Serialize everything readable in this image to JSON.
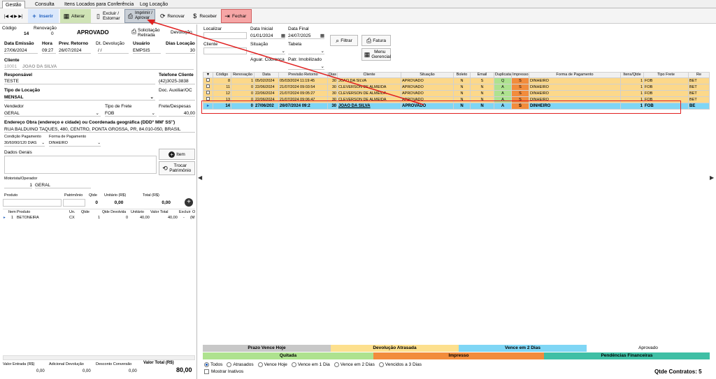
{
  "tabs": [
    "Gestão",
    "Consulta",
    "Itens Locados para Conferência",
    "Log Locação"
  ],
  "toolbar": {
    "nav": "|◀ ◀ ▶ ▶|",
    "insert": "Inserir",
    "alter": "Alterar",
    "delete": "Excluir / Estornar",
    "print": "Imprimir / Aprovar",
    "renew": "Renovar",
    "receive": "Receber",
    "close": "Fechar"
  },
  "form": {
    "codigo_label": "Código",
    "codigo": "14",
    "renovacao_label": "Renovação",
    "renovacao": "0",
    "status": "APROVADO",
    "solicitacao": "Solicitação Retirada",
    "devolucao": "Devolução",
    "data_emissao_label": "Data Emissão",
    "data_emissao": "27/06/2024",
    "hora_label": "Hora",
    "hora": "09:27",
    "prev_retorno_label": "Prev. Retorno",
    "prev_retorno": "26/07/2024",
    "dt_devolucao_label": "Dt. Devolução",
    "dt_devolucao": "/ /",
    "usuario_label": "Usuário",
    "usuario": "EMPSIS",
    "dias_locacao_label": "Dias Locação",
    "dias_locacao": "30",
    "cliente_label": "Cliente",
    "cliente_code": "10001",
    "cliente_name": "JOAO DA SILVA",
    "responsavel_label": "Responsável",
    "responsavel": "TESTE",
    "telefone_label": "Telefone Cliente",
    "telefone": "(42)3025-3838",
    "tipo_locacao_label": "Tipo de Locação",
    "tipo_locacao": "MENSAL",
    "doc_aux_label": "Doc. Auxiliar/OC",
    "vendedor_label": "Vendedor",
    "vendedor": "GERAL",
    "tipo_frete_label": "Tipo de Frete",
    "tipo_frete": "FOB",
    "frete_label": "Frete/Despesas",
    "frete": "40,00",
    "endereco_label": "Endereço Obra (endereço e cidade) ou Coordenada geográfica (DDD° MM' SS'')",
    "endereco": "RUA BALDUINO TAQUES, 480, CENTRO, PONTA GROSSA, PR, 84.010-050, BRASIL",
    "cond_pag_label": "Condição Pagamento",
    "cond_pag": "30/60/90/120 DIAS",
    "forma_pag_label": "Forma de Pagamento",
    "forma_pag": "DINHEIRO",
    "dados_gerais_label": "Dados Gerais",
    "item_btn": "Item",
    "trocar_btn": "Trocar Patrimônio",
    "motorista_label": "Motorista/Operador",
    "motorista_code": "1",
    "motorista": "GERAL",
    "produto_label": "Produto",
    "patrimonio_label": "Patrimônio",
    "qtde_label": "Qtde",
    "qtde": "0",
    "unitario_label": "Unitário (R$)",
    "unitario": "0,00",
    "total_label": "Total (R$)",
    "total": "0,00"
  },
  "items": {
    "headers": [
      "Item",
      "Produto",
      "Un.",
      "Qtde",
      "Qtde Devolvida",
      "Unitário",
      "Valor Total",
      "Excluir",
      "O"
    ],
    "rows": [
      [
        "1",
        "BETONEIRA",
        "CX",
        "1",
        "0",
        "40,00",
        "40,00",
        "-",
        "(M"
      ]
    ]
  },
  "footer": {
    "valor_entrada_label": "Valor Entrada (R$)",
    "valor_entrada": "0,00",
    "adicional_label": "Adicional Devolução",
    "adicional": "0,00",
    "desconto_label": "Desconto Conversão",
    "desconto": "0,00",
    "valor_total_label": "Valor Total (R$)",
    "valor_total": "80,00"
  },
  "filters": {
    "localizar": "Localizar",
    "data_inicial_label": "Data Inicial",
    "data_inicial": "01/01/2024",
    "data_final_label": "Data Final",
    "data_final": "24/07/2025",
    "filtrar": "Filtrar",
    "fatura": "Fatura",
    "menu": "Menu Gerencial",
    "cliente": "Cliente",
    "situacao": "Situação",
    "tabela": "Tabela",
    "aguar": "Aguar. Cobrança",
    "patr": "Patr. Imobilizado"
  },
  "grid": {
    "headers": [
      "Código",
      "Renovação",
      "Data",
      "Previsão Retorno",
      "Dias",
      "Cliente",
      "Situação",
      "Boleto",
      "Email",
      "Duplicata",
      "Impresso",
      "Forma de Pagamento",
      "Itens/Qtde",
      "Tipo Frete",
      "Re"
    ],
    "rows": [
      [
        "8",
        "1",
        "05/02/2024",
        "05/03/2024 11:19:45",
        "30",
        "JOAO DA SILVA",
        "APROVADO",
        "N",
        "S",
        "Q",
        "S",
        "DINHEIRO",
        "1",
        "FOB",
        "BET"
      ],
      [
        "11",
        "0",
        "22/06/2024",
        "21/07/2024 09:03:54",
        "30",
        "CLEVERSON DE ALMEIDA",
        "APROVADO",
        "N",
        "N",
        "A",
        "S",
        "DINHEIRO",
        "1",
        "FOB",
        "BET"
      ],
      [
        "12",
        "0",
        "22/06/2024",
        "21/07/2024 09:05:27",
        "30",
        "CLEVERSON DE ALMEIDA",
        "APROVADO",
        "N",
        "N",
        "A",
        "S",
        "DINHEIRO",
        "1",
        "FOB",
        "BET"
      ],
      [
        "13",
        "0",
        "22/06/2024",
        "21/07/2024 09:06:47",
        "30",
        "CLEVERSON DE ALMEIDA",
        "APROVADO",
        "N",
        "N",
        "A",
        "S",
        "DINHEIRO",
        "1",
        "FOB",
        "BET"
      ],
      [
        "14",
        "0",
        "27/06/202",
        "26/07/2024 09:2",
        "30",
        "JOAO DA SILVA",
        "APROVADO",
        "N",
        "N",
        "A",
        "S",
        "DINHEIRO",
        "1",
        "FOB",
        "BE"
      ]
    ]
  },
  "legend": {
    "prazo": "Prazo Vence Hoje",
    "devolucao": "Devolução Atrasada",
    "vence2": "Vence em 2 Dias",
    "aprovado": "Aprovado",
    "quitada": "Quitada",
    "impresso": "Impresso",
    "pendencias": "Pendências Financeiras"
  },
  "radios": [
    "Todos",
    "Atrasados",
    "Vence Hoje",
    "Vence em 1 Dia",
    "Vence em 2 Dias",
    "Vencidos a 3 Dias"
  ],
  "mostrar": "Mostrar Inativos",
  "qtde_contratos": "Qtde Contratos: 5",
  "colors": {
    "yellow": "#fcd88a",
    "selected": "#7fd6f5",
    "orange": "#f28c3c",
    "green": "#3fbfa5",
    "annotation": "#e02020"
  }
}
